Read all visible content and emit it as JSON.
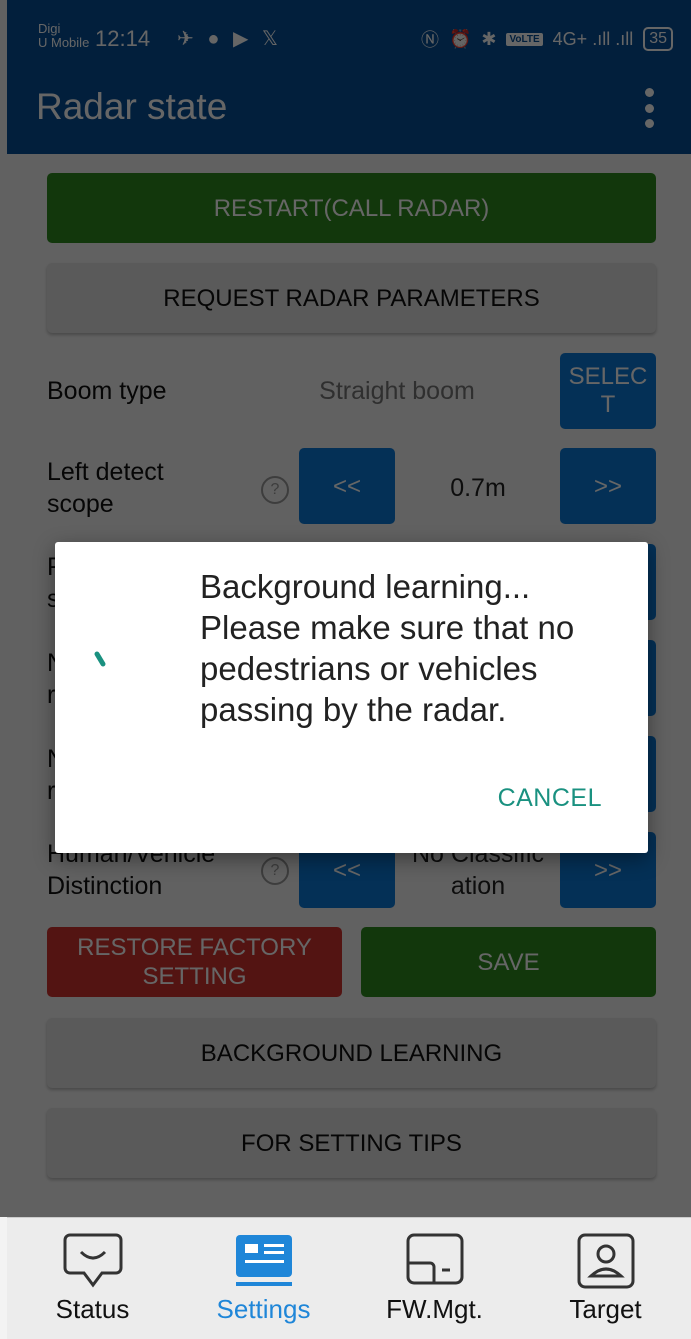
{
  "status_bar": {
    "carrier_line1": "Digi",
    "carrier_line2": "U Mobile",
    "time": "12:14",
    "app_icons": "✈ ● ▶ 𝕏",
    "nfc": "Ⓝ",
    "alarm": "⏰",
    "bluetooth": "✱",
    "volte": "VoLTE",
    "signal": "4G+ .ıll  .ıll",
    "battery": "35"
  },
  "app_bar": {
    "title": "Radar state"
  },
  "content": {
    "restart_label": "RESTART(CALL RADAR)",
    "request_params_label": "REQUEST RADAR PARAMETERS",
    "boom_type": {
      "label": "Boom type",
      "value": "Straight boom",
      "select_label": "SELEC\nT"
    },
    "left_detect_scope": {
      "label": "Left detect\nscope",
      "help": "?",
      "decrease": "<<",
      "value": "0.7m",
      "increase": ">>"
    },
    "hidden_rows": [
      {
        "label_fragment": "F\ns"
      },
      {
        "label_fragment": "N\nr"
      },
      {
        "label_fragment": "N\nr"
      }
    ],
    "human_vehicle": {
      "label": "Human/Vehicle\nDistinction",
      "help": "?",
      "decrease": "<<",
      "value": "No Classific\nation",
      "increase": ">>"
    },
    "restore_label": "RESTORE FACTORY\nSETTING",
    "save_label": "SAVE",
    "background_learning_label": "BACKGROUND LEARNING",
    "setting_tips_label": "FOR SETTING TIPS"
  },
  "bottom_nav": {
    "items": [
      {
        "label": "Status",
        "icon": "chat-bubble-icon",
        "active": false
      },
      {
        "label": "Settings",
        "icon": "settings-card-icon",
        "active": true
      },
      {
        "label": "FW.Mgt.",
        "icon": "firmware-icon",
        "active": false
      },
      {
        "label": "Target",
        "icon": "target-person-icon",
        "active": false
      }
    ],
    "active_color": "#1f86d8"
  },
  "dialog": {
    "message": "Background learning...\nPlease make sure that no\npedestrians or vehicles\npassing by the radar.",
    "cancel_label": "CANCEL",
    "accent_color": "#1a9180"
  },
  "colors": {
    "primary": "#074e96",
    "green_button": "#2e8b1f",
    "red_button": "#d0322f",
    "blue_button": "#0b79d6"
  }
}
